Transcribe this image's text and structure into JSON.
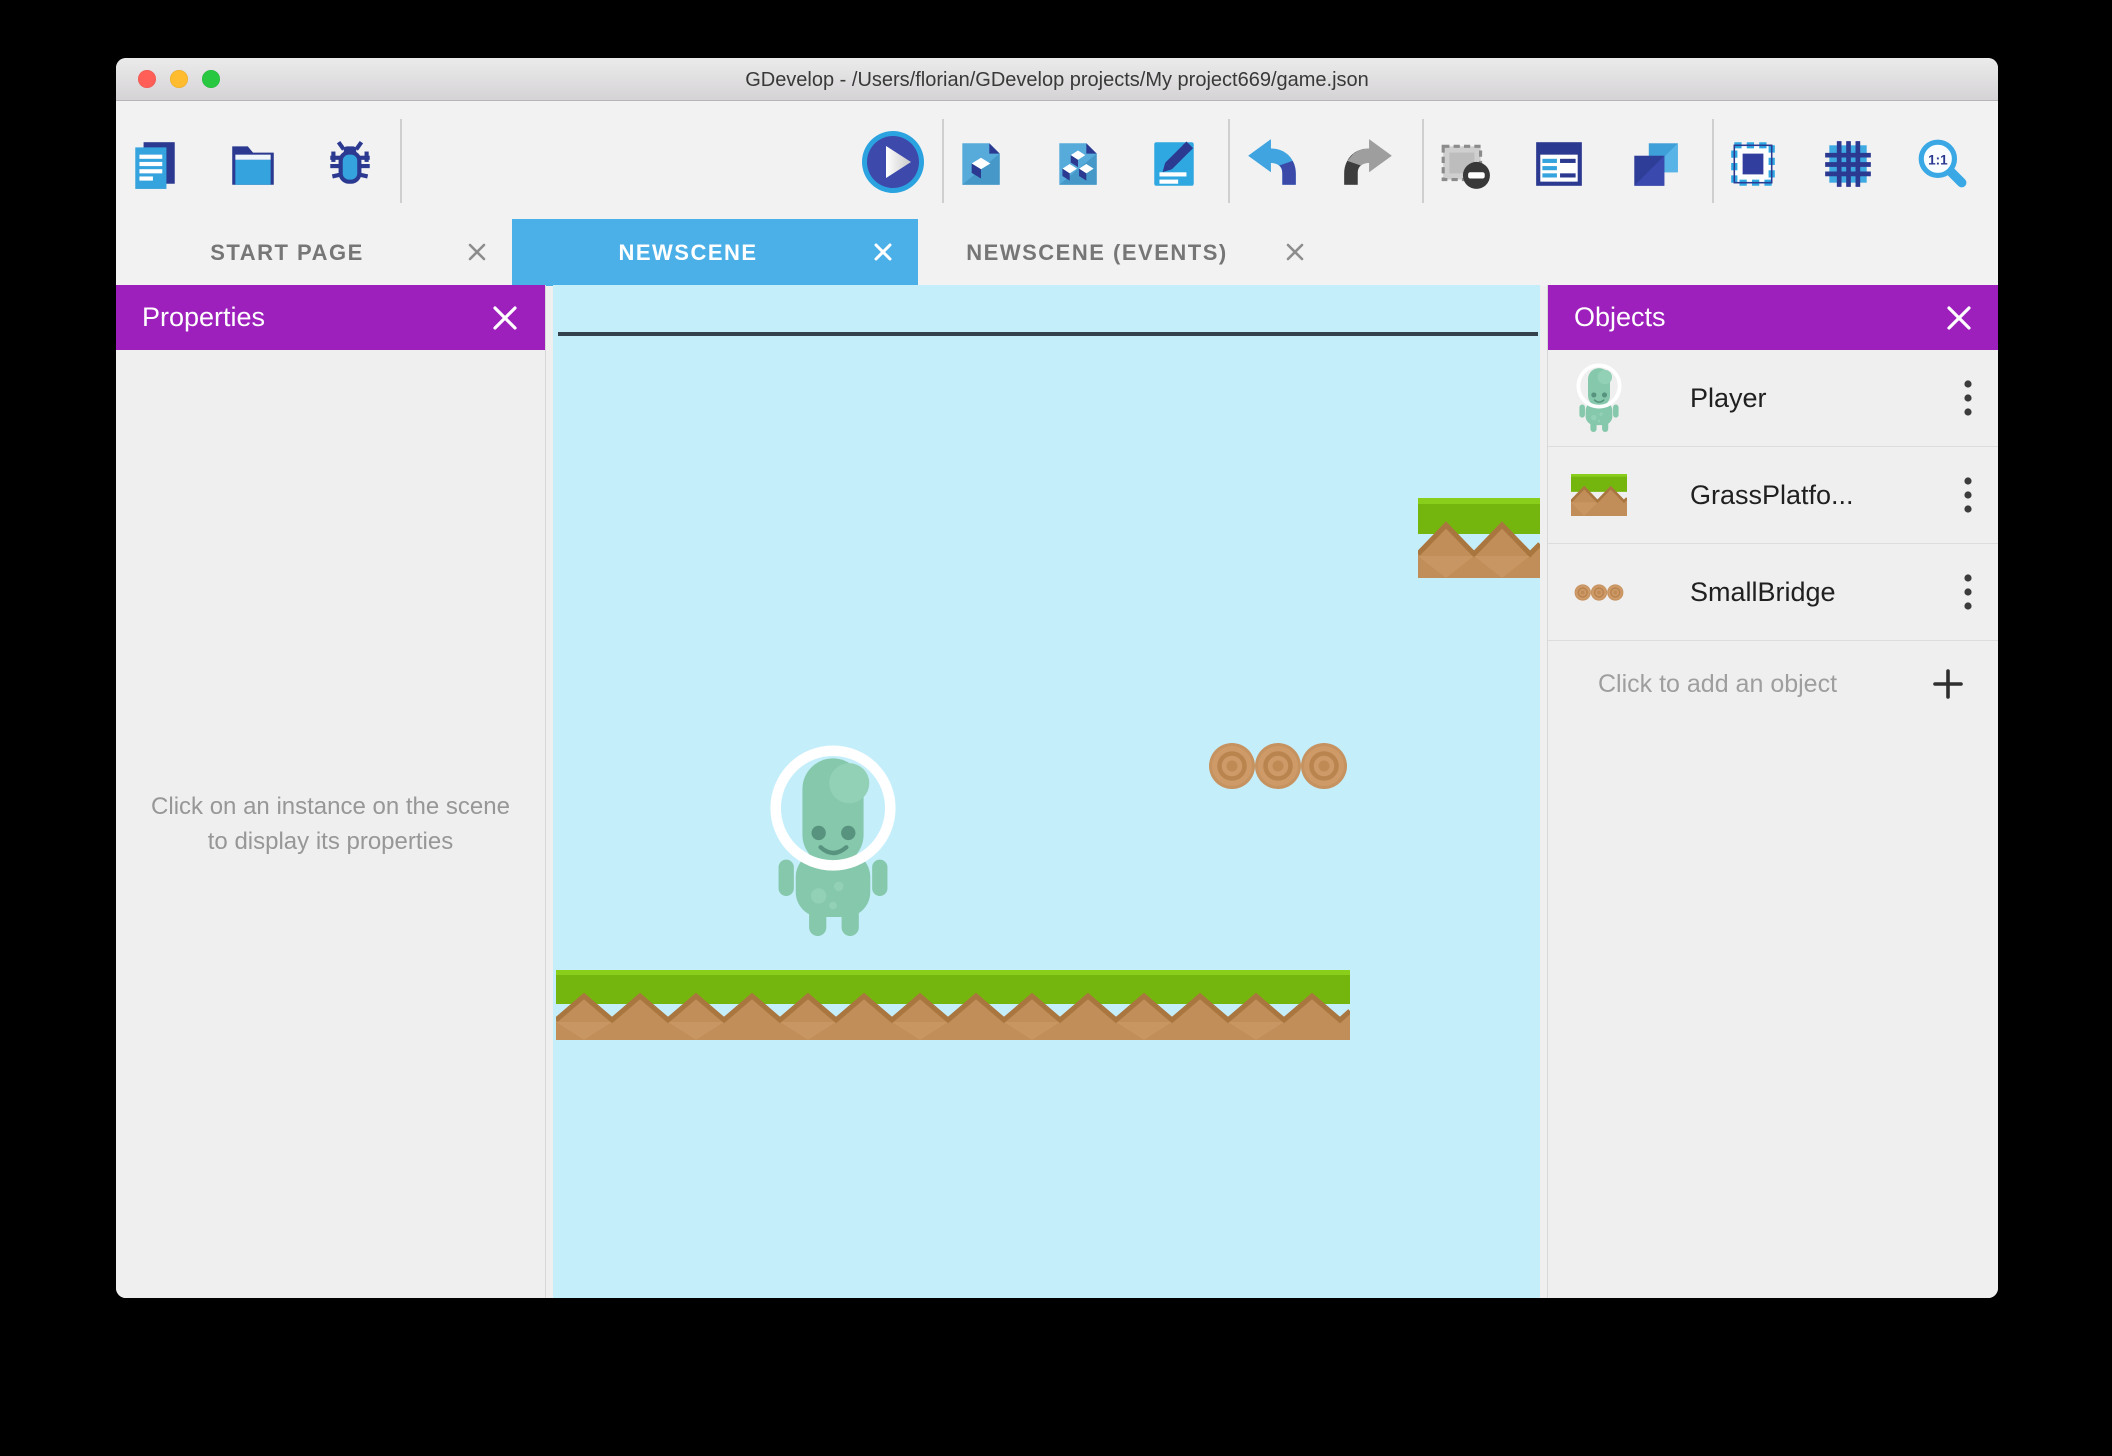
{
  "window": {
    "title": "GDevelop - /Users/florian/GDevelop projects/My project669/game.json",
    "traffic_lights": [
      "close",
      "minimize",
      "zoom"
    ]
  },
  "toolbar": {
    "buttons": [
      "project-manager",
      "open-project",
      "debugger",
      "play",
      "add-object",
      "objects-groups",
      "scene-properties",
      "undo",
      "redo",
      "delete-instances",
      "instances-list",
      "layers",
      "mask",
      "grid",
      "zoom-original"
    ]
  },
  "tabs": {
    "close_glyph": "✕",
    "items": [
      {
        "label": "START PAGE",
        "active": false
      },
      {
        "label": "NEWSCENE",
        "active": true
      },
      {
        "label": "NEWSCENE (EVENTS)",
        "active": false
      }
    ]
  },
  "properties_panel": {
    "title": "Properties",
    "empty_text": "Click on an instance on the scene to display its properties"
  },
  "objects_panel": {
    "title": "Objects",
    "items": [
      {
        "label": "Player",
        "thumbnail": "player-thumbnail"
      },
      {
        "label": "GrassPlatfo...",
        "thumbnail": "grass-platform-thumbnail"
      },
      {
        "label": "SmallBridge",
        "thumbnail": "small-bridge-thumbnail"
      }
    ],
    "add_label": "Click to add an object",
    "add_icon": "plus-icon"
  },
  "scene": {
    "instances": [
      "player",
      "grass-platform",
      "small-bridge",
      "grass-platform-corner"
    ]
  },
  "colors": {
    "accent_purple": "#9d1fbc",
    "tab_active_blue": "#4cb0e8",
    "scene_background": "#c5eefb",
    "icon_navy": "#2b3990",
    "icon_blue": "#35a3dd",
    "grass_green": "#74b60d",
    "dirt_brown": "#c18d58"
  }
}
